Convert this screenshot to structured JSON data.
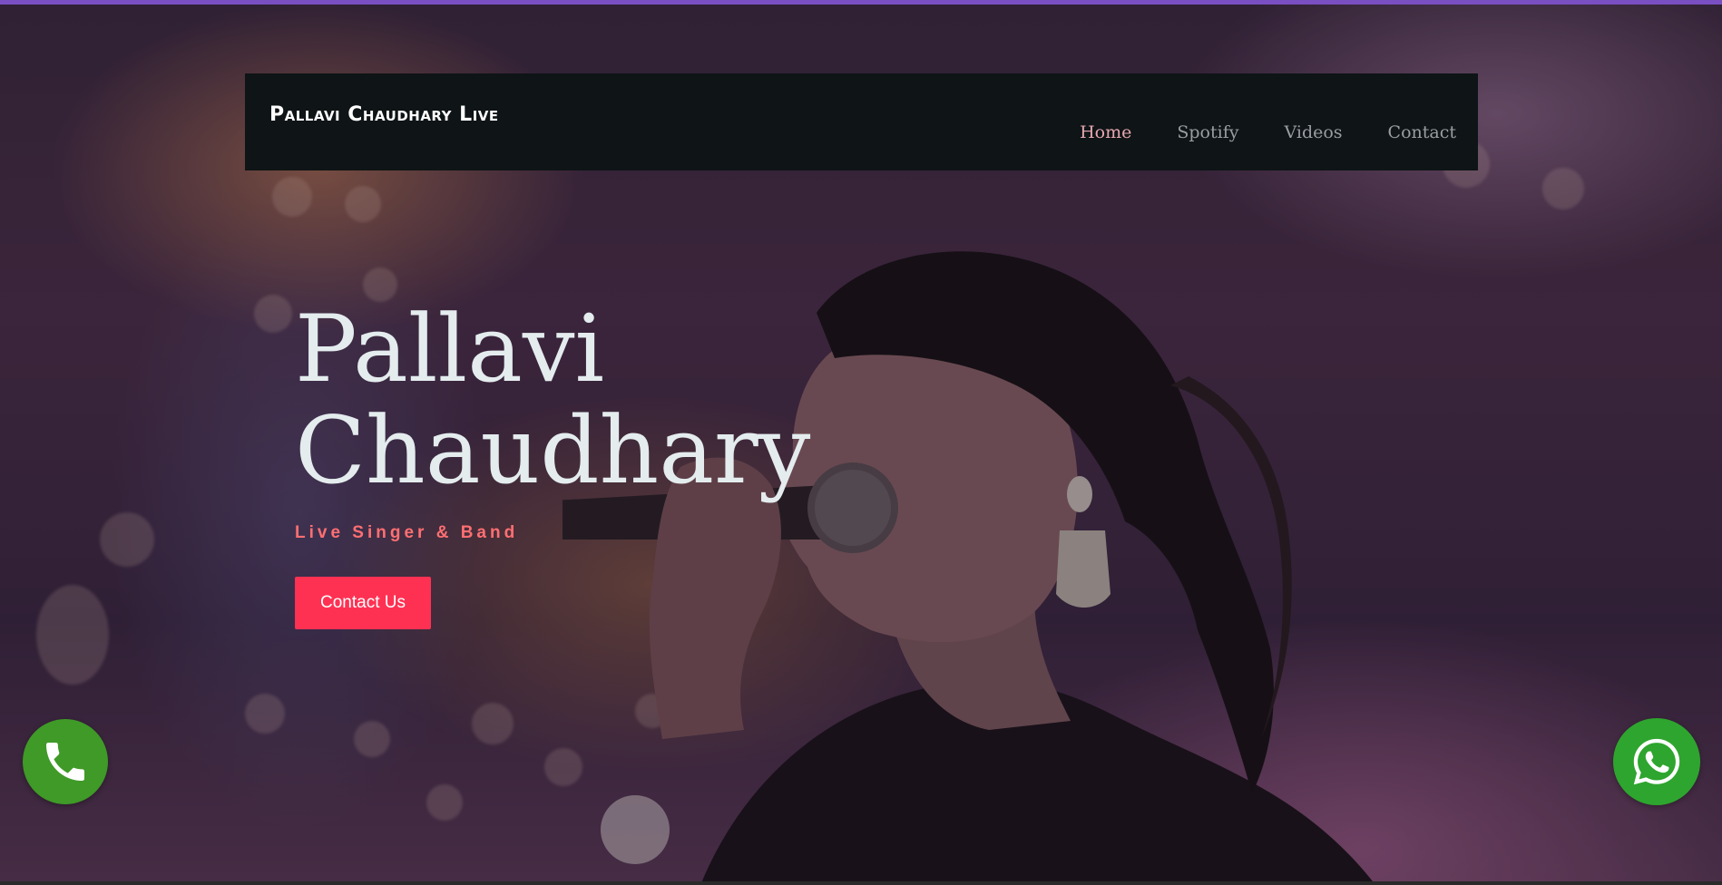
{
  "brand": {
    "name": "Pallavi Chaudhary Live"
  },
  "nav": {
    "items": [
      {
        "label": "Home",
        "active": true
      },
      {
        "label": "Spotify",
        "active": false
      },
      {
        "label": "Videos",
        "active": false
      },
      {
        "label": "Contact",
        "active": false
      }
    ]
  },
  "hero": {
    "title_line1": "Pallavi",
    "title_line2": "Chaudhary",
    "subtitle": "Live Singer & Band",
    "cta_label": "Contact Us"
  },
  "floating": {
    "call_icon": "phone-icon",
    "whatsapp_icon": "whatsapp-icon"
  },
  "colors": {
    "accent_top": "#7a4fc2",
    "navbar_bg": "#0f1416",
    "nav_active": "#e6a8b0",
    "subtitle": "#ff6f72",
    "cta_bg": "#ff3153",
    "call_bg": "#3f9a27",
    "whatsapp_bg": "#2ea52e"
  }
}
